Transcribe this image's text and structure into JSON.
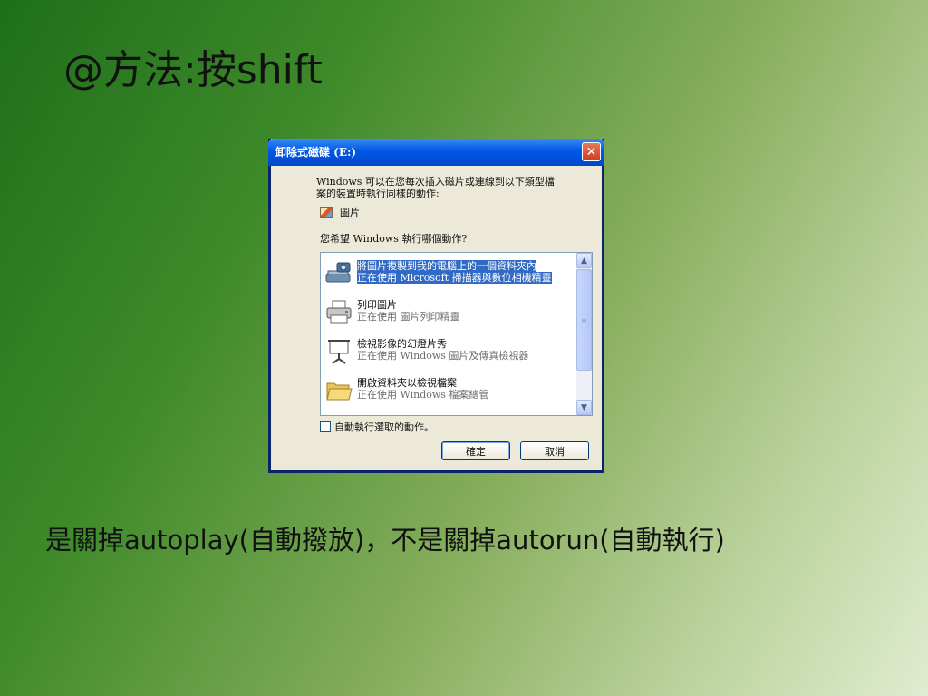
{
  "slide": {
    "title": "@方法:按shift",
    "caption": "是關掉autoplay(自動撥放)，不是關掉autorun(自動執行)"
  },
  "dialog": {
    "title": "卸除式磁碟 (E:)",
    "intro_line1": "Windows 可以在您每次插入磁片或連線到以下類型檔",
    "intro_line2": "案的裝置時執行同樣的動作:",
    "content_type": "圖片",
    "prompt": "您希望 Windows 執行哪個動作?",
    "actions": [
      {
        "label": "將圖片複製到我的電腦上的一個資料夾內",
        "program": "正在使用 Microsoft 掃描器與數位相機精靈",
        "icon": "scanner-camera-icon",
        "selected": true
      },
      {
        "label": "列印圖片",
        "program": "正在使用 圖片列印精靈",
        "icon": "printer-icon",
        "selected": false
      },
      {
        "label": "檢視影像的幻燈片秀",
        "program": "正在使用 Windows 圖片及傳真檢視器",
        "icon": "projector-screen-icon",
        "selected": false
      },
      {
        "label": "開啟資料夾以檢視檔案",
        "program": "正在使用 Windows 檔案總管",
        "icon": "folder-icon",
        "selected": false
      }
    ],
    "always_label": "自動執行選取的動作。",
    "ok_label": "確定",
    "cancel_label": "取消",
    "colors": {
      "titlebar": "#0058e6",
      "selection": "#316ac5",
      "close": "#d13b1c"
    }
  }
}
